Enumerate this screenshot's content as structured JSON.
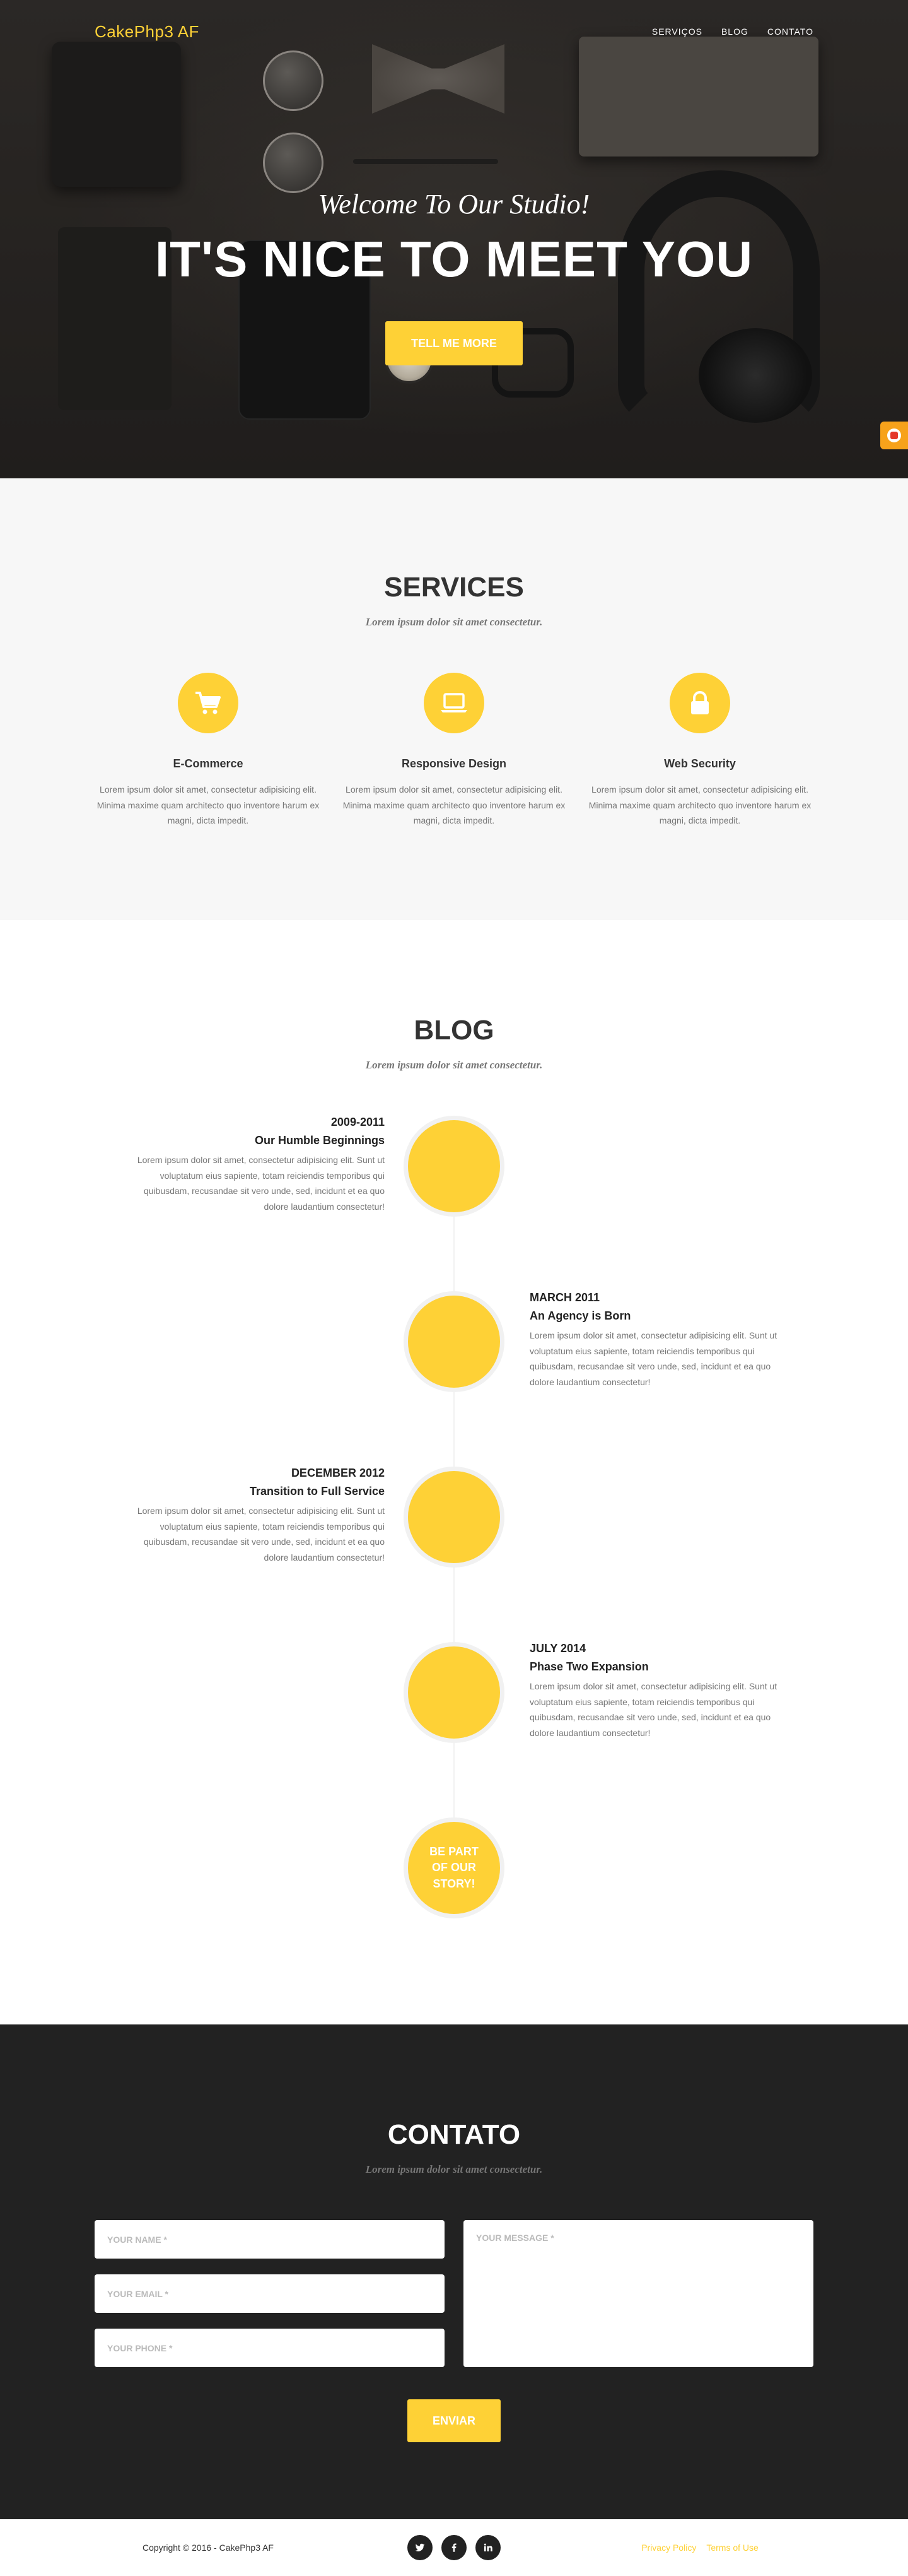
{
  "header": {
    "brand": "CakePhp3 AF",
    "nav": [
      "SERVIÇOS",
      "BLOG",
      "CONTATO"
    ]
  },
  "hero": {
    "lead": "Welcome To Our Studio!",
    "heading": "IT'S NICE TO MEET YOU",
    "button": "TELL ME MORE"
  },
  "services": {
    "heading": "SERVICES",
    "subheading": "Lorem ipsum dolor sit amet consectetur.",
    "items": [
      {
        "icon": "shopping-cart-icon",
        "title": "E-Commerce",
        "text": "Lorem ipsum dolor sit amet, consectetur adipisicing elit. Minima maxime quam architecto quo inventore harum ex magni, dicta impedit."
      },
      {
        "icon": "laptop-icon",
        "title": "Responsive Design",
        "text": "Lorem ipsum dolor sit amet, consectetur adipisicing elit. Minima maxime quam architecto quo inventore harum ex magni, dicta impedit."
      },
      {
        "icon": "lock-icon",
        "title": "Web Security",
        "text": "Lorem ipsum dolor sit amet, consectetur adipisicing elit. Minima maxime quam architecto quo inventore harum ex magni, dicta impedit."
      }
    ]
  },
  "blog": {
    "heading": "BLOG",
    "subheading": "Lorem ipsum dolor sit amet consectetur.",
    "timeline": [
      {
        "date": "2009-2011",
        "title": "Our Humble Beginnings",
        "text": "Lorem ipsum dolor sit amet, consectetur adipisicing elit. Sunt ut voluptatum eius sapiente, totam reiciendis temporibus qui quibusdam, recusandae sit vero unde, sed, incidunt et ea quo dolore laudantium consectetur!"
      },
      {
        "date": "MARCH 2011",
        "title": "An Agency is Born",
        "text": "Lorem ipsum dolor sit amet, consectetur adipisicing elit. Sunt ut voluptatum eius sapiente, totam reiciendis temporibus qui quibusdam, recusandae sit vero unde, sed, incidunt et ea quo dolore laudantium consectetur!"
      },
      {
        "date": "DECEMBER 2012",
        "title": "Transition to Full Service",
        "text": "Lorem ipsum dolor sit amet, consectetur adipisicing elit. Sunt ut voluptatum eius sapiente, totam reiciendis temporibus qui quibusdam, recusandae sit vero unde, sed, incidunt et ea quo dolore laudantium consectetur!"
      },
      {
        "date": "JULY 2014",
        "title": "Phase Two Expansion",
        "text": "Lorem ipsum dolor sit amet, consectetur adipisicing elit. Sunt ut voluptatum eius sapiente, totam reiciendis temporibus qui quibusdam, recusandae sit vero unde, sed, incidunt et ea quo dolore laudantium consectetur!"
      }
    ],
    "final": "BE PART OF OUR STORY!"
  },
  "contact": {
    "heading": "CONTATO",
    "subheading": "Lorem ipsum dolor sit amet consectetur.",
    "name_placeholder": "YOUR NAME *",
    "email_placeholder": "YOUR EMAIL *",
    "phone_placeholder": "YOUR PHONE *",
    "message_placeholder": "YOUR MESSAGE *",
    "submit": "ENVIAR"
  },
  "footer": {
    "copyright": "Copyright © 2016 - CakePhp3 AF",
    "socials": [
      "twitter-icon",
      "facebook-icon",
      "linkedin-icon"
    ],
    "links": [
      "Privacy Policy",
      "Terms of Use"
    ]
  },
  "colors": {
    "accent": "#fed136",
    "dark": "#222222",
    "light_bg": "#f7f7f7"
  }
}
